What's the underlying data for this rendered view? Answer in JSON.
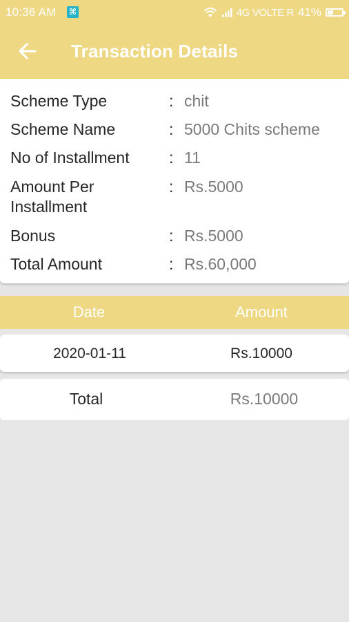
{
  "status_bar": {
    "time": "10:36 AM",
    "app_icon_glyph": "⌘",
    "network": "4G VOLTE R",
    "battery": "41%",
    "battery_level": 0.41
  },
  "app_bar": {
    "back_icon": "arrow-left",
    "title": "Transaction Details"
  },
  "details": [
    {
      "label": "Scheme Type",
      "value": "chit"
    },
    {
      "label": "Scheme Name",
      "value": "5000 Chits scheme"
    },
    {
      "label": "No of Installment",
      "value": "11"
    },
    {
      "label": "Amount Per Installment",
      "value": "Rs.5000"
    },
    {
      "label": "Bonus",
      "value": "Rs.5000"
    },
    {
      "label": "Total Amount",
      "value": "Rs.60,000"
    }
  ],
  "separator": ":",
  "table": {
    "headers": [
      "Date",
      "Amount"
    ],
    "rows": [
      {
        "date": "2020-01-11",
        "amount": "Rs.10000"
      }
    ]
  },
  "total": {
    "label": "Total",
    "value": "Rs.10000"
  },
  "colors": {
    "primary": "#eed883",
    "background": "#e6e6e6"
  }
}
